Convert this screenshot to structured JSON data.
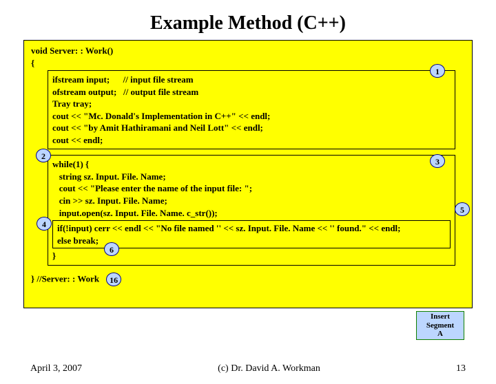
{
  "title": "Example Method (C++)",
  "code": {
    "head1": "void Server: : Work()",
    "head2": "{",
    "b1l1": "ifstream input;      // input file stream",
    "b1l2": "ofstream output;   // output file stream",
    "b1l3": "Tray tray;",
    "b1l4": "cout << \"Mc. Donald's Implementation in C++\" << endl;",
    "b1l5": "cout << \"by Amit Hathiramani and Neil Lott\" << endl;",
    "b1l6": "cout << endl;",
    "wl1": "while(1) {",
    "wl2": "   string sz. Input. File. Name;",
    "wl3": "   cout << \"Please enter the name of the input file: \";",
    "wl4": "   cin >> sz. Input. File. Name;",
    "wl5": "   input.open(sz. Input. File. Name. c_str());",
    "inn": "if(!input) cerr << endl << \"No file named '' << sz. Input. File. Name << '' found.\" << endl;\nelse break;",
    "wend": "}",
    "tail": "} //Server: : Work"
  },
  "bubbles": {
    "b1": "1",
    "b2": "2",
    "b3": "3",
    "b4": "4",
    "b5": "5",
    "b6": "6",
    "b16": "16"
  },
  "segment": "Insert\nSegment\nA",
  "footer": {
    "left": "April 3, 2007",
    "center": "(c) Dr. David A. Workman",
    "right": "13"
  }
}
